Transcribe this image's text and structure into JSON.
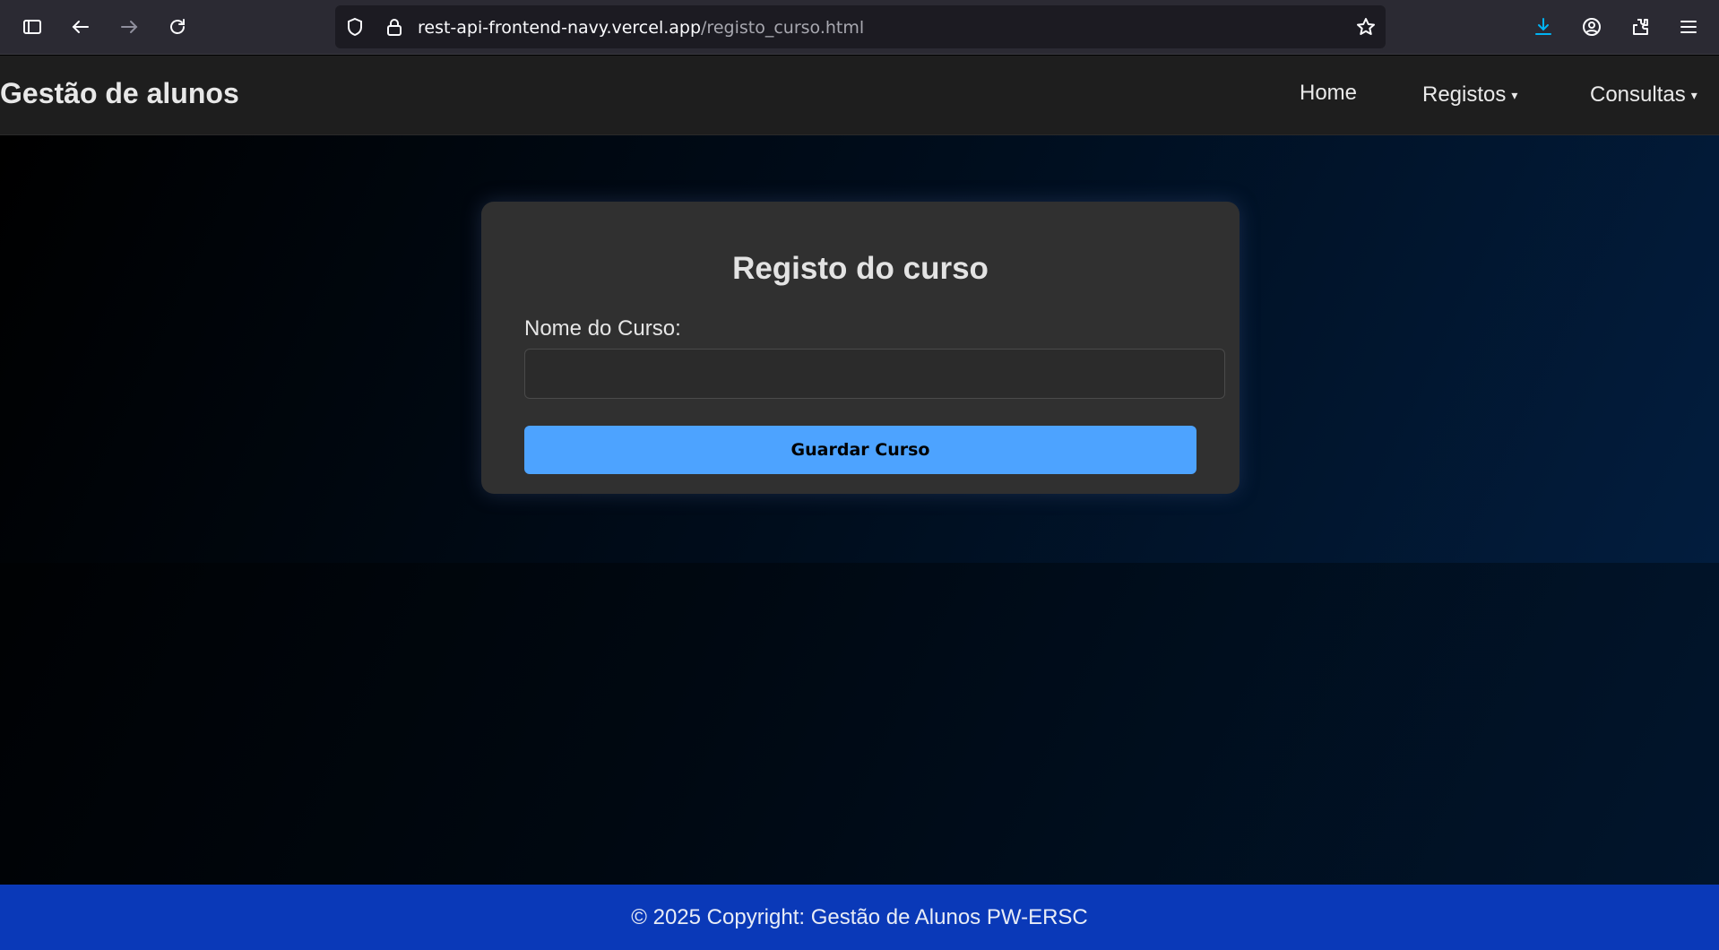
{
  "browser": {
    "url_host": "rest-api-frontend-navy.vercel.app",
    "url_path": "/registo_curso.html",
    "icons": [
      "sidebar-icon",
      "back-icon",
      "forward-icon",
      "reload-icon",
      "shield-icon",
      "lock-icon",
      "star-icon",
      "download-icon",
      "account-icon",
      "extensions-icon",
      "menu-icon"
    ],
    "accent_color": "#00b3f4"
  },
  "header": {
    "brand": "Gestão de alunos",
    "nav": {
      "home": "Home",
      "registos": "Registos",
      "consultas": "Consultas",
      "caret": "▾"
    }
  },
  "form": {
    "title": "Registo do curso",
    "course_name_label": "Nome do Curso:",
    "course_name_value": "",
    "submit_label": "Guardar Curso"
  },
  "footer": {
    "text": "© 2025 Copyright: Gestão de Alunos PW-ERSC"
  },
  "colors": {
    "button": "#4da3ff",
    "footer": "#0a39b8",
    "card": "#303030"
  }
}
